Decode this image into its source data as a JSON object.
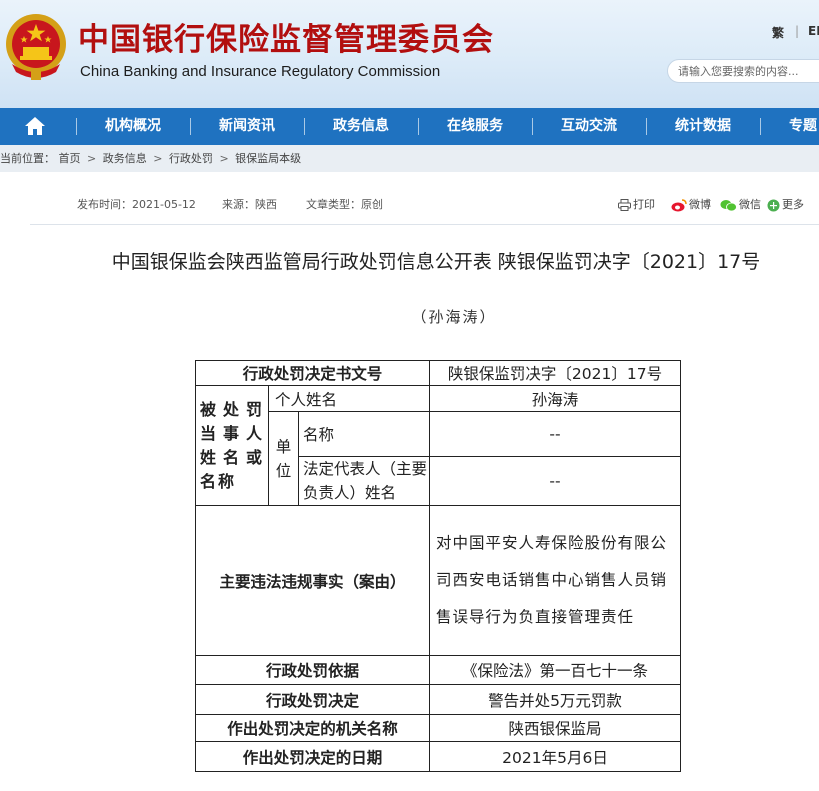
{
  "site": {
    "title_cn": "中国银行保险监督管理委员会",
    "title_en": "China Banking and Insurance Regulatory Commission",
    "lang_trad": "繁",
    "lang_en": "EN",
    "search_placeholder": "请输入您要搜索的内容..."
  },
  "nav": {
    "items": [
      "机构概况",
      "新闻资讯",
      "政务信息",
      "在线服务",
      "互动交流",
      "统计数据",
      "专题"
    ]
  },
  "breadcrumb": {
    "label": "当前位置：",
    "items": [
      "首页",
      "政务信息",
      "行政处罚",
      "银保监局本级"
    ]
  },
  "meta": {
    "publish": "发布时间：2021-05-12",
    "source": "来源：陕西",
    "type": "文章类型：原创"
  },
  "share": {
    "print": "打印",
    "weibo": "微博",
    "wechat": "微信",
    "more": "更多"
  },
  "doc": {
    "title": "中国银保监会陕西监管局行政处罚信息公开表 陕银保监罚决字〔2021〕17号",
    "subtitle": "（孙海涛）"
  },
  "table": {
    "r1_label": "行政处罚决定书文号",
    "r1_value": "陕银保监罚决字〔2021〕17号",
    "party_label": "被处罚当事人姓名或名称",
    "person_label": "个人姓名",
    "person_value": "孙海涛",
    "unit_label": "单位",
    "unit_name_label": "名称",
    "unit_name_value": "--",
    "unit_rep_label": "法定代表人（主要负责人）姓名",
    "unit_rep_value": "--",
    "facts_label": "主要违法违规事实（案由）",
    "facts_value": "对中国平安人寿保险股份有限公司西安电话销售中心销售人员销售误导行为负直接管理责任",
    "basis_label": "行政处罚依据",
    "basis_value": "《保险法》第一百七十一条",
    "decision_label": "行政处罚决定",
    "decision_value": "警告并处5万元罚款",
    "org_label": "作出处罚决定的机关名称",
    "org_value": "陕西银保监局",
    "date_label": "作出处罚决定的日期",
    "date_value": "2021年5月6日"
  },
  "colors": {
    "brand_red": "#b20f0f",
    "nav_blue": "#1f72c0",
    "header_bg": "#dcebf8"
  }
}
